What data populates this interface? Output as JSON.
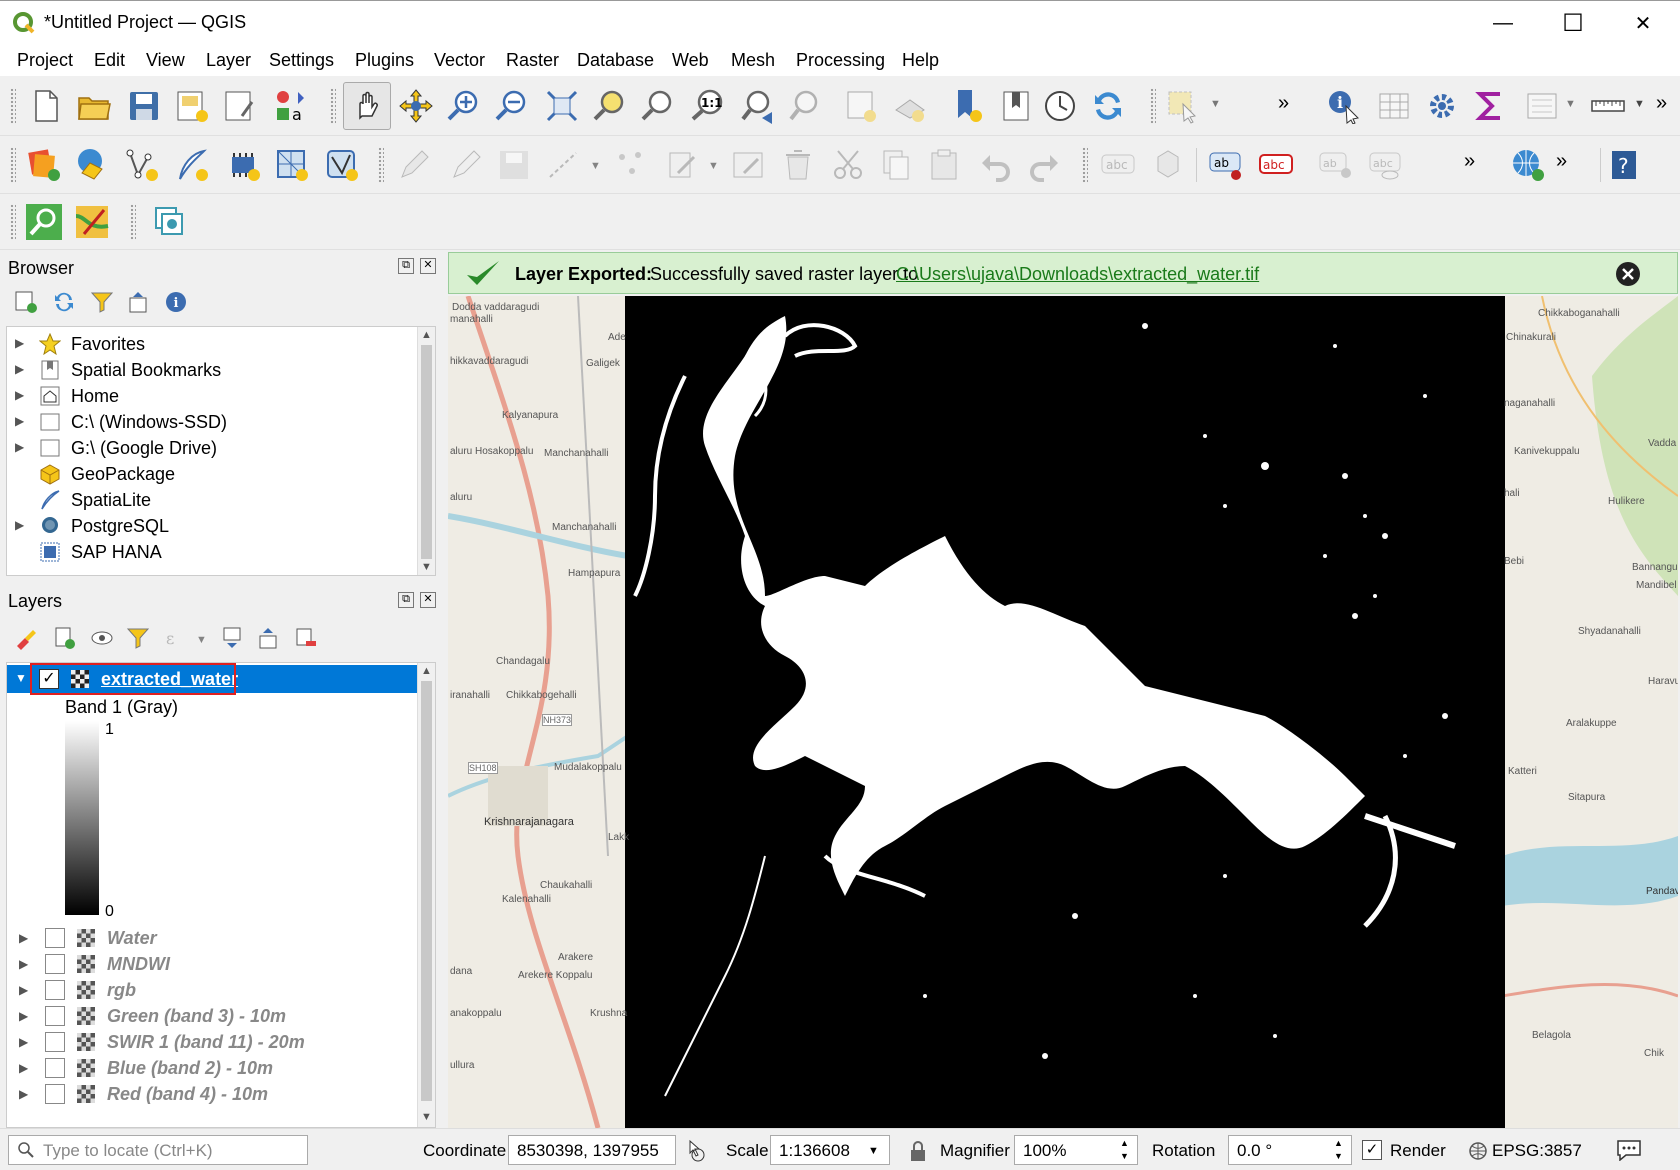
{
  "window": {
    "title": "*Untitled Project — QGIS",
    "minimize": "—",
    "maximize": "☐",
    "close": "✕"
  },
  "menu": [
    "Project",
    "Edit",
    "View",
    "Layer",
    "Settings",
    "Plugins",
    "Vector",
    "Raster",
    "Database",
    "Web",
    "Mesh",
    "Processing",
    "Help"
  ],
  "browser": {
    "title": "Browser",
    "items": [
      {
        "label": "Favorites",
        "icon": "star-icon"
      },
      {
        "label": "Spatial Bookmarks",
        "icon": "bookmark-icon"
      },
      {
        "label": "Home",
        "icon": "home-icon"
      },
      {
        "label": "C:\\ (Windows-SSD)",
        "icon": "drive-icon"
      },
      {
        "label": "G:\\ (Google Drive)",
        "icon": "drive-icon"
      },
      {
        "label": "GeoPackage",
        "icon": "geopackage-icon"
      },
      {
        "label": "SpatiaLite",
        "icon": "spatialite-icon"
      },
      {
        "label": "PostgreSQL",
        "icon": "postgresql-icon"
      },
      {
        "label": "SAP HANA",
        "icon": "sap-hana-icon"
      }
    ]
  },
  "layers": {
    "title": "Layers",
    "active": {
      "name": "extracted_water",
      "band": "Band 1 (Gray)",
      "legend_max": "1",
      "legend_min": "0"
    },
    "items": [
      {
        "name": "Water"
      },
      {
        "name": "MNDWI"
      },
      {
        "name": "rgb"
      },
      {
        "name": "Green (band 3) - 10m"
      },
      {
        "name": "SWIR 1 (band 11) - 20m"
      },
      {
        "name": "Blue (band 2) - 10m"
      },
      {
        "name": "Red (band 4) - 10m"
      }
    ]
  },
  "message": {
    "bold": "Layer Exported:",
    "text": "Successfully saved raster layer to",
    "link": "C:\\Users\\ujava\\Downloads\\extracted_water.tif"
  },
  "map_labels": [
    "Dodda vaddaragudi",
    "manahalli",
    "hikkavaddaragudi",
    "Kalyanapura",
    "aluru Hosakoppalu",
    "Manchanahalli",
    "aluru",
    "Manchanahalli",
    "Hampapura",
    "Chandagalu",
    "Chikkabogehalli",
    "iranahalli",
    "NH373",
    "SH108",
    "Mudalakoppalu",
    "Krishnarajanagara",
    "Chaukahalli",
    "Kalenahalli",
    "Arakere",
    "Arekere Koppalu",
    "dana",
    "anakoppalu",
    "Krushna",
    "ullura",
    "Galigek",
    "Ade",
    "Lakk",
    "Chikkaboganahalli",
    "Chinakurali",
    "naganahalli",
    "Kanivekuppalu",
    "hali",
    "Vadda",
    "Hulikere",
    "Bebi",
    "Bannanguppe",
    "Mandibel",
    "Shyadanahalli",
    "Haravu",
    "Aralakuppe",
    "Katteri",
    "Sitapura",
    "Belagola",
    "Pandav",
    "Chik"
  ],
  "status": {
    "locate_placeholder": "Type to locate (Ctrl+K)",
    "coordinate_label": "Coordinate",
    "coordinate": "8530398, 1397955",
    "scale_label": "Scale",
    "scale": "1:136608",
    "magnifier_label": "Magnifier",
    "magnifier": "100%",
    "rotation_label": "Rotation",
    "rotation": "0.0 °",
    "render_label": "Render",
    "crs": "EPSG:3857"
  },
  "colors": {
    "accent": "#0078d7",
    "message_bg": "#d8f0d0",
    "highlight_red": "#e02020"
  }
}
